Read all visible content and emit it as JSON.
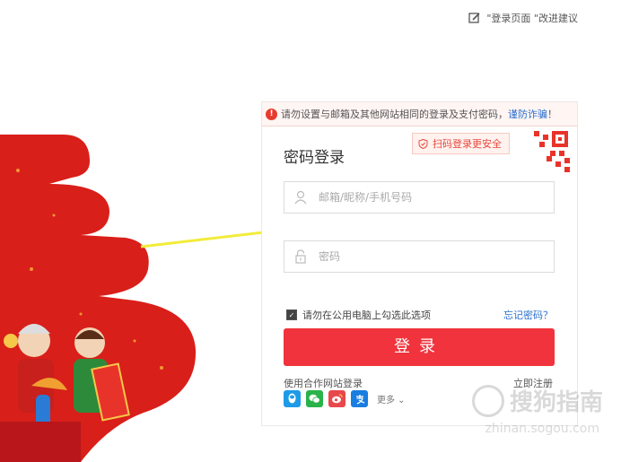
{
  "top_links": {
    "feedback": "\"登录页面 \"改进建议"
  },
  "warning": {
    "text": "请勿设置与邮箱及其他网站相同的登录及支付密码，",
    "link": "谨防诈骗",
    "suffix": "！"
  },
  "login": {
    "title": "密码登录",
    "scan_tip": "扫码登录更安全",
    "username_placeholder": "邮箱/昵称/手机号码",
    "password_placeholder": "密码",
    "remember_label": "请勿在公用电脑上勾选此选项",
    "forgot_label": "忘记密码？",
    "submit_label": "登录",
    "partner_label": "使用合作网站登录",
    "register_label": "立即注册",
    "more_label": "更多 ⌄"
  },
  "social_icons": [
    {
      "name": "qq-icon",
      "color": "#1e9be8"
    },
    {
      "name": "wechat-icon",
      "color": "#29b34a"
    },
    {
      "name": "weibo-icon",
      "color": "#e8484c"
    },
    {
      "name": "alipay-icon",
      "color": "#1a7de0"
    }
  ],
  "watermark": {
    "text": "搜狗指南",
    "url": "zhinan.sogou.com"
  },
  "colors": {
    "accent": "#f0333c",
    "link": "#2a6fcf",
    "deco_red": "#d91f1a",
    "arrow": "#f2ec3a"
  }
}
